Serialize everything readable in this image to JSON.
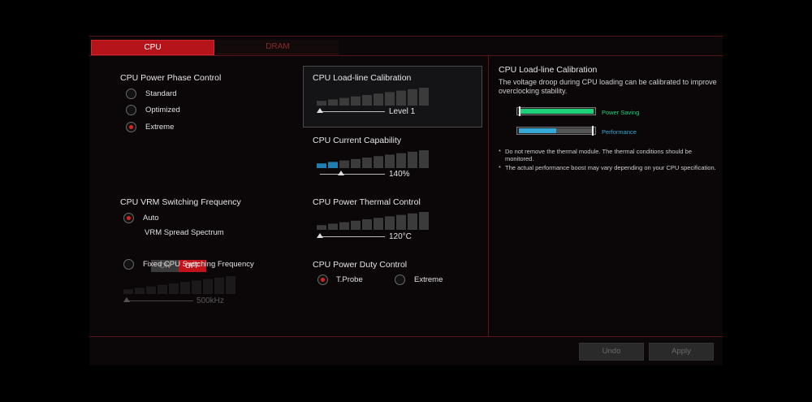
{
  "tabs": {
    "cpu": "CPU",
    "dram": "DRAM"
  },
  "phase": {
    "title": "CPU Power Phase Control",
    "options": [
      "Standard",
      "Optimized",
      "Extreme"
    ],
    "selected": "Extreme"
  },
  "vrm": {
    "title": "CPU VRM Switching Frequency",
    "auto_label": "Auto",
    "spread_label": "VRM Spread Spectrum",
    "toggle_on": "ON",
    "toggle_off": "OFF",
    "toggle_state": "OFF",
    "fixed_label": "Fixed CPU Switching Frequency",
    "fixed_value": "500kHz"
  },
  "llc": {
    "title": "CPU Load-line Calibration",
    "value": "Level 1",
    "level": 0.0
  },
  "current": {
    "title": "CPU Current Capability",
    "value": "140%",
    "level": 0.2
  },
  "thermal": {
    "title": "CPU Power Thermal Control",
    "value": "120°C",
    "level": 0.0
  },
  "duty": {
    "title": "CPU Power Duty Control",
    "options": [
      "T.Probe",
      "Extreme"
    ],
    "selected": "T.Probe"
  },
  "info": {
    "title": "CPU Load-line Calibration",
    "description": "The voltage droop during CPU loading can be calibrated to improve overclocking stability.",
    "bar1_label": "Power Saving",
    "bar2_label": "Performance",
    "note1_star": "*",
    "note1": "Do not remove the thermal module. The thermal conditions should be monitored.",
    "note2_star": "*",
    "note2": "The actual performance boost may vary depending on your CPU specification."
  },
  "buttons": {
    "undo": "Undo",
    "apply": "Apply"
  },
  "colors": {
    "accent": "#b4141a",
    "green": "#1fd07a",
    "blue": "#35a8d8"
  }
}
